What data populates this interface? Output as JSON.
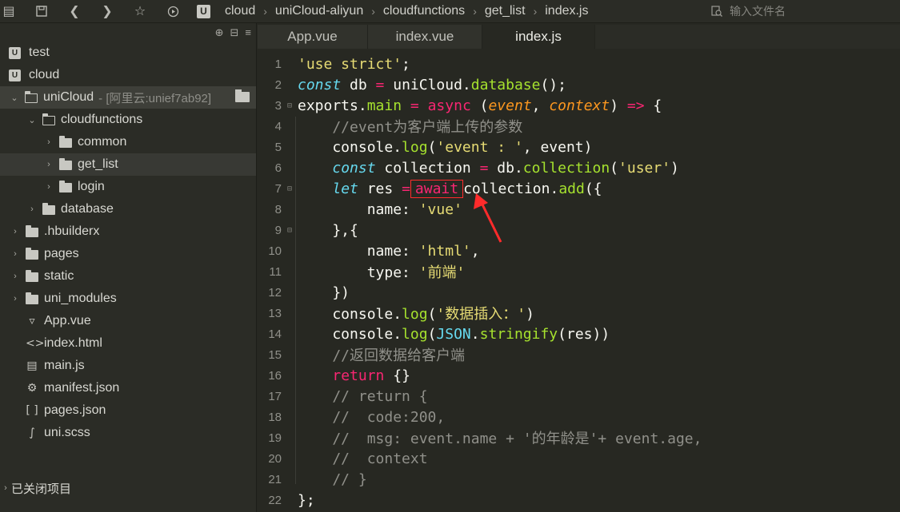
{
  "toolbar": {
    "icons": [
      "menu-icon",
      "save-icon",
      "back-icon",
      "forward-icon",
      "star-icon",
      "run-icon"
    ],
    "breadcrumb": [
      "cloud",
      "uniCloud-aliyun",
      "cloudfunctions",
      "get_list",
      "index.js"
    ],
    "file_search_placeholder": "输入文件名"
  },
  "sidebar": {
    "items": [
      {
        "label": "test"
      },
      {
        "label": "cloud"
      },
      {
        "label": "uniCloud",
        "hint": "- [阿里云:unief7ab92]"
      },
      {
        "label": "cloudfunctions"
      },
      {
        "label": "common"
      },
      {
        "label": "get_list"
      },
      {
        "label": "login"
      },
      {
        "label": "database"
      },
      {
        "label": ".hbuilderx"
      },
      {
        "label": "pages"
      },
      {
        "label": "static"
      },
      {
        "label": "uni_modules"
      },
      {
        "label": "App.vue"
      },
      {
        "label": "index.html"
      },
      {
        "label": "main.js"
      },
      {
        "label": "manifest.json"
      },
      {
        "label": "pages.json"
      },
      {
        "label": "uni.scss"
      }
    ],
    "closed_projects": "已关闭项目"
  },
  "tabs": [
    {
      "label": "App.vue"
    },
    {
      "label": "index.vue"
    },
    {
      "label": "index.js"
    }
  ],
  "editor": {
    "line_numbers": [
      "1",
      "2",
      "3",
      "4",
      "5",
      "6",
      "7",
      "8",
      "9",
      "10",
      "11",
      "12",
      "13",
      "14",
      "15",
      "16",
      "17",
      "18",
      "19",
      "20",
      "21",
      "22"
    ],
    "colors": {
      "highlight_box": "#ff2b2b",
      "arrow": "#ff2b2b"
    }
  }
}
